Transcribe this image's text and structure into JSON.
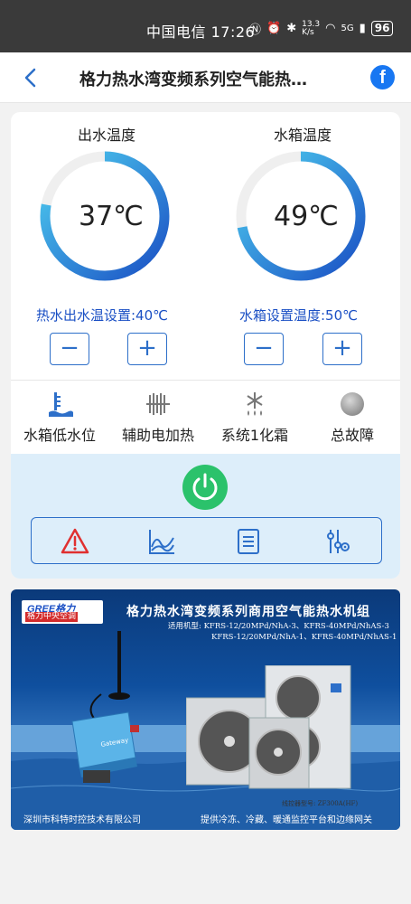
{
  "statusbar": {
    "carrier": "中国电信 17:26",
    "net_speed": "13.3 K/s",
    "signal": "5G",
    "battery": "96"
  },
  "navbar": {
    "title": "格力热水湾变频系列空气能热…",
    "back_icon": "back-chevron-icon",
    "fb_icon": "facebook-icon",
    "fb_letter": "f"
  },
  "gauges": [
    {
      "title": "出水温度",
      "value": "37℃",
      "fill": 0.78
    },
    {
      "title": "水箱温度",
      "value": "49℃",
      "fill": 0.72
    }
  ],
  "settings": [
    {
      "label": "热水出水温设置:40℃",
      "minus": "−",
      "plus": "+"
    },
    {
      "label": "水箱设置温度:50℃",
      "minus": "−",
      "plus": "+"
    }
  ],
  "status_items": [
    {
      "label": "水箱低水位",
      "icon": "water-level-icon"
    },
    {
      "label": "辅助电加热",
      "icon": "electric-heater-icon"
    },
    {
      "label": "系统1化霜",
      "icon": "defrost-icon"
    },
    {
      "label": "总故障",
      "icon": "fault-indicator-icon"
    }
  ],
  "controls": {
    "power_icon": "power-icon",
    "toolbar": [
      "warning-icon",
      "chart-icon",
      "list-icon",
      "settings-sliders-icon"
    ]
  },
  "banner": {
    "logo_text": "GREE格力",
    "logo_sub": "格力中央空调",
    "title": "格力热水湾变频系列商用空气能热水机组",
    "model_line1": "适用机型: KFRS-12/20MPd/NhA-3、KFRS-40MPd/NhAS-3",
    "model_line2": "KFRS-12/20MPd/NhA-1、KFRS-40MPd/NhAS-1",
    "controller": "线控器型号: ZF300A(HF)",
    "device_brand": "Gateway",
    "footer_left": "深圳市科特时控技术有限公司",
    "footer_right": "提供冷冻、冷藏、暖通监控平台和边缘网关"
  },
  "colors": {
    "accent": "#2d6fc9",
    "gauge_start": "#1a4fc4",
    "gauge_end": "#4fd0f0",
    "power": "#2bc26b",
    "warning": "#e03030"
  }
}
